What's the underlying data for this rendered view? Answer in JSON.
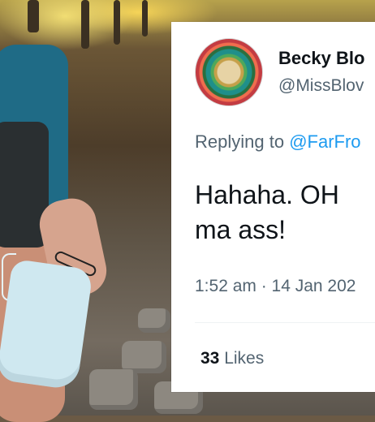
{
  "tweet": {
    "display_name": "Becky Blo",
    "handle": "@MissBlov",
    "replying_prefix": "Replying to ",
    "replying_mention": "@FarFro",
    "text_lines": [
      "Hahaha. OH",
      "ma ass!"
    ],
    "timestamp": "1:52 am · 14 Jan 202",
    "likes_count": "33",
    "likes_label": "Likes"
  },
  "colors": {
    "text_primary": "#0f1419",
    "text_secondary": "#536471",
    "link": "#1d9bf0",
    "card_bg": "#ffffff"
  },
  "icons": {
    "avatar": "avatar-icon"
  }
}
